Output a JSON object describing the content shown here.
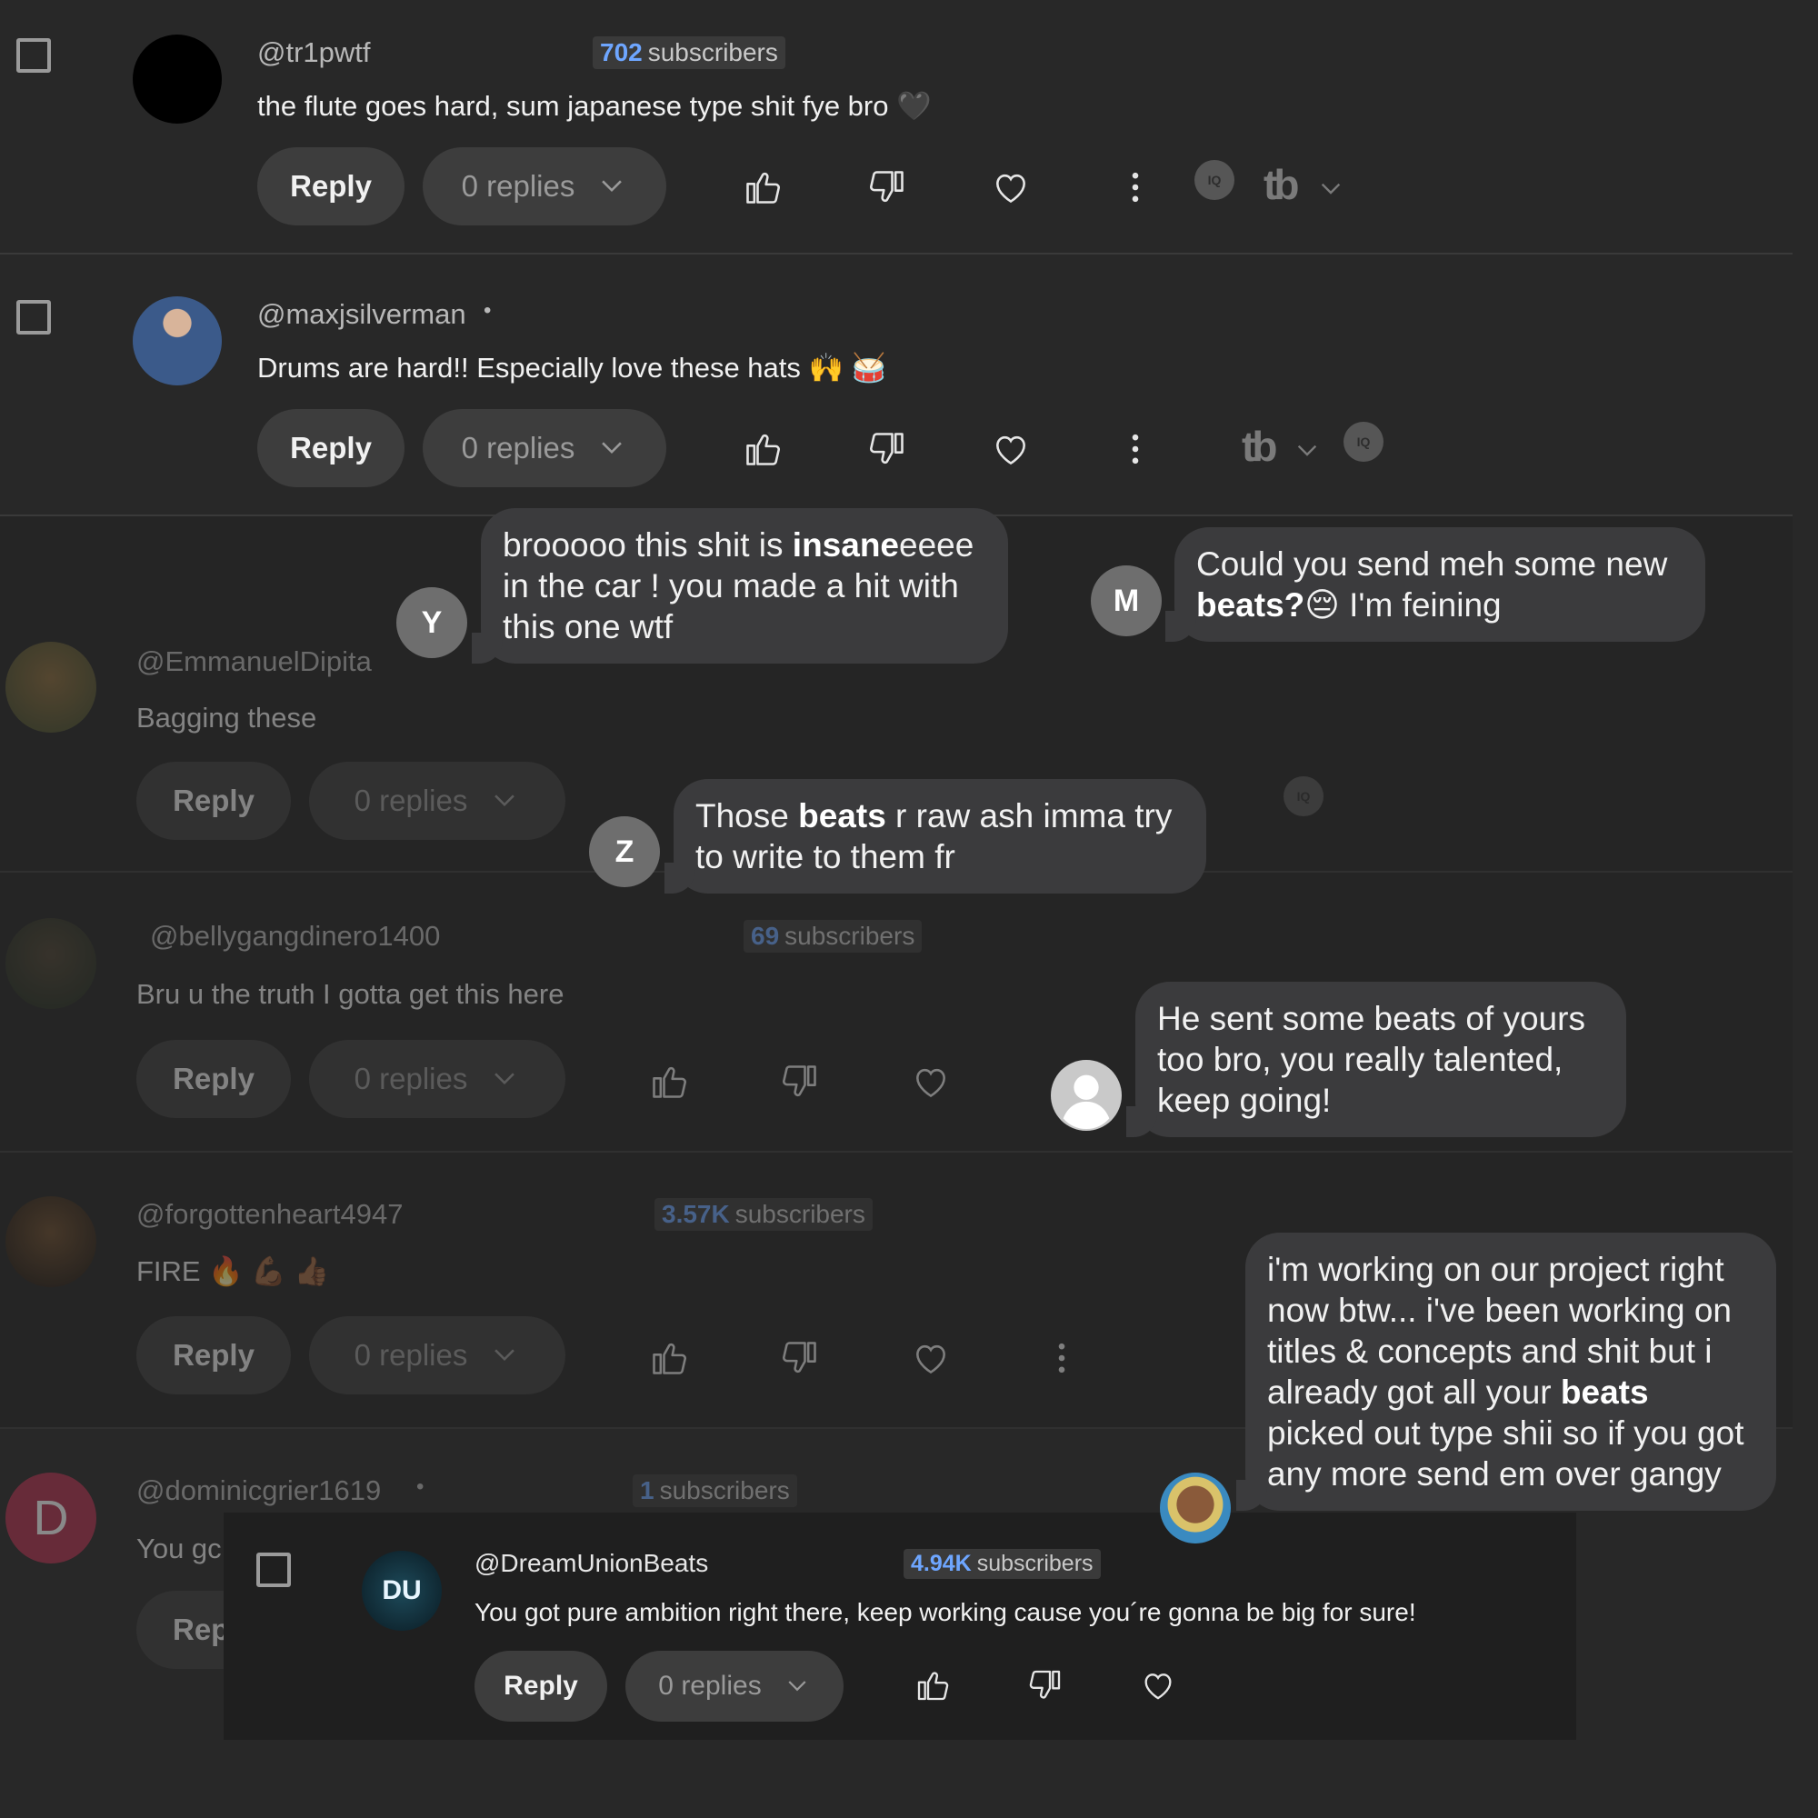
{
  "comments": [
    {
      "handle": "@tr1pwtf",
      "subs_count": "702",
      "subs_label": "subscribers",
      "text": "the flute goes hard, sum japanese type shit fye bro 🖤",
      "reply": "Reply",
      "replies": "0 replies"
    },
    {
      "handle": "@maxjsilverman",
      "dot": "•",
      "text": "Drums are hard!! Especially love these hats 🙌 🥁",
      "reply": "Reply",
      "replies": "0 replies"
    },
    {
      "handle": "@EmmanuelDipita",
      "text": "Bagging these",
      "reply": "Reply",
      "replies": "0 replies"
    },
    {
      "handle": "@bellygangdinero1400",
      "subs_count": "69",
      "subs_label": "subscribers",
      "text": "Bru u the truth I gotta get this here",
      "reply": "Reply",
      "replies": "0 replies"
    },
    {
      "handle": "@forgottenheart4947",
      "subs_count": "3.57K",
      "subs_label": "subscribers",
      "text": "FIRE 🔥 💪🏾 👍🏾",
      "reply": "Reply",
      "replies": "0 replies"
    },
    {
      "handle": "@dominicgrier1619",
      "dot": "•",
      "subs_count": "1",
      "subs_label": "subscribers",
      "text": "You gc",
      "reply": "Rep",
      "avatar_letter": "D"
    },
    {
      "handle": "@DreamUnionBeats",
      "subs_count": "4.94K",
      "subs_label": "subscribers",
      "text": "You got pure ambition right there, keep working cause you´re gonna be big for sure!",
      "reply": "Reply",
      "replies": "0 replies",
      "avatar_text": "DU"
    }
  ],
  "messages": [
    {
      "initial": "Y",
      "parts": [
        [
          "brooooo this shit is ",
          ""
        ],
        [
          "insane",
          "b"
        ],
        [
          "eeee in the car ! you made a hit with this one wtf",
          ""
        ]
      ]
    },
    {
      "initial": "M",
      "parts": [
        [
          "Could you send meh some new ",
          ""
        ],
        [
          "beats?",
          "b"
        ],
        [
          "😔 I'm feining",
          ""
        ]
      ]
    },
    {
      "initial": "Z",
      "parts": [
        [
          "Those ",
          ""
        ],
        [
          "beats",
          "b"
        ],
        [
          " r raw ash imma try to write to them fr",
          ""
        ]
      ]
    },
    {
      "initial": "",
      "parts": [
        [
          "He sent some beats of yours too bro, you really talented, keep going!",
          ""
        ]
      ]
    },
    {
      "initial": "",
      "parts": [
        [
          "i'm working on our project right now btw... i've been working on titles & concepts and shit but i already got all your ",
          ""
        ],
        [
          "beats",
          "b"
        ],
        [
          " picked out type shii so if you got any more send em over gangy",
          ""
        ]
      ]
    }
  ],
  "badges": {
    "iq": "IQ",
    "tb": "tb"
  },
  "colors": {
    "background": "#282828",
    "pill": "#3d3d3d",
    "bubble": "#3b3b3d",
    "subs_accent": "#6ea6ff"
  }
}
